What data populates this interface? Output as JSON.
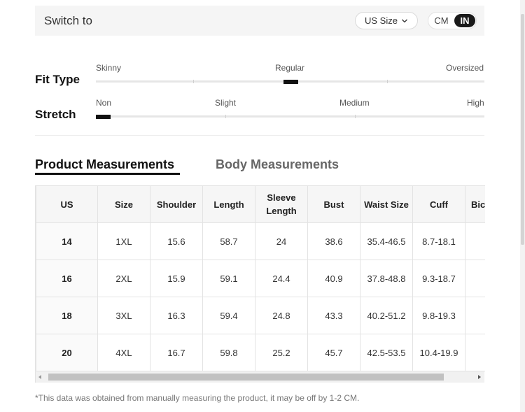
{
  "header": {
    "switch_label": "Switch to",
    "size_select_value": "US Size",
    "units": {
      "cm": "CM",
      "in": "IN",
      "selected": "IN"
    }
  },
  "fit_type": {
    "label": "Fit Type",
    "options": [
      "Skinny",
      "Regular",
      "Oversized"
    ],
    "selected": "Regular"
  },
  "stretch": {
    "label": "Stretch",
    "options": [
      "Non",
      "Slight",
      "Medium",
      "High"
    ],
    "selected": "Non"
  },
  "tabs": {
    "product": "Product Measurements",
    "body": "Body Measurements",
    "active": "Product Measurements"
  },
  "table": {
    "headers": [
      "US",
      "Size",
      "Shoulder",
      "Length",
      "Sleeve Length",
      "Bust",
      "Waist Size",
      "Cuff",
      "Bicep Length"
    ],
    "rows": [
      [
        "14",
        "1XL",
        "15.6",
        "58.7",
        "24",
        "38.6",
        "35.4-46.5",
        "8.7-18.1",
        ""
      ],
      [
        "16",
        "2XL",
        "15.9",
        "59.1",
        "24.4",
        "40.9",
        "37.8-48.8",
        "9.3-18.7",
        ""
      ],
      [
        "18",
        "3XL",
        "16.3",
        "59.4",
        "24.8",
        "43.3",
        "40.2-51.2",
        "9.8-19.3",
        ""
      ],
      [
        "20",
        "4XL",
        "16.7",
        "59.8",
        "25.2",
        "45.7",
        "42.5-53.5",
        "10.4-19.9",
        ""
      ]
    ]
  },
  "footer": {
    "disclaimer": "*This data was obtained from manually measuring the product, it may be off by 1-2 CM."
  }
}
